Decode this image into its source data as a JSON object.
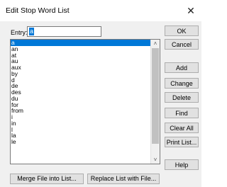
{
  "window": {
    "title": "Edit Stop Word List",
    "close_glyph": "✕"
  },
  "entry": {
    "label": "Entry:",
    "value": "a"
  },
  "list": {
    "items": [
      "a",
      "an",
      "at",
      "au",
      "aux",
      "by",
      "d",
      "de",
      "des",
      "du",
      "for",
      "from",
      "i",
      "in",
      "l",
      "la",
      "le"
    ],
    "selected_index": 0
  },
  "scrollbar": {
    "up_glyph": "˄",
    "down_glyph": "˅"
  },
  "buttons": {
    "ok": "OK",
    "cancel": "Cancel",
    "add": "Add",
    "change": "Change",
    "delete": "Delete",
    "find": "Find",
    "clear_all": "Clear All",
    "print_list": "Print List...",
    "help": "Help",
    "merge": "Merge File into List...",
    "replace": "Replace List with File..."
  }
}
